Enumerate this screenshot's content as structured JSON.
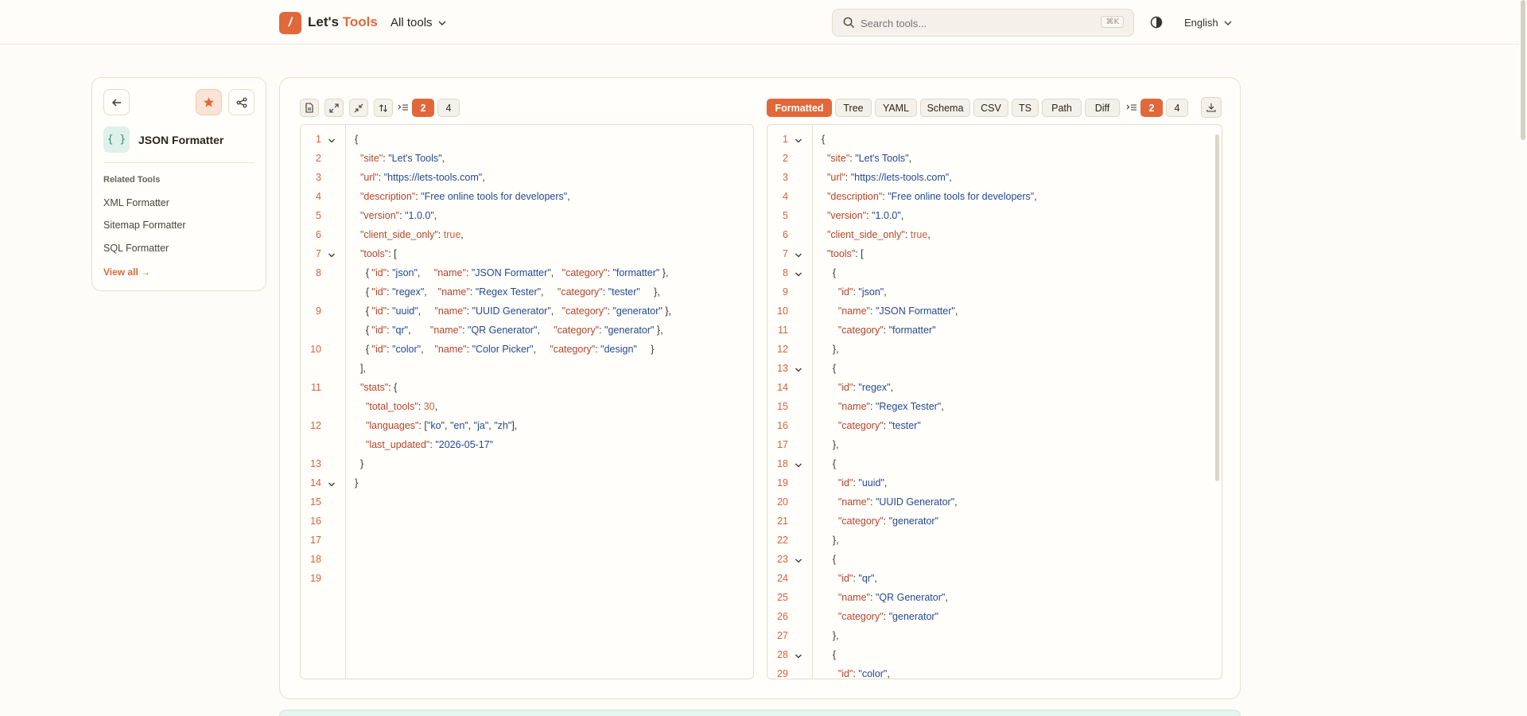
{
  "header": {
    "logo_mark": "/",
    "logo_part1": "Let's ",
    "logo_part2": "Tools",
    "all_tools_label": "All tools",
    "search_placeholder": "Search tools...",
    "search_shortcut": "⌘K",
    "language": "English",
    "accent_color": "#e0683a"
  },
  "sidebar": {
    "tool_icon_glyph": "{ }",
    "tool_name": "JSON Formatter",
    "related_title": "Related Tools",
    "related_items": [
      "XML Formatter",
      "Sitemap Formatter",
      "SQL Formatter"
    ],
    "view_all": "View all →"
  },
  "toolbar_left": {
    "indent_options": [
      "2",
      "4"
    ],
    "active_indent": "2"
  },
  "toolbar_right": {
    "view_tabs": [
      "Formatted",
      "Tree",
      "YAML",
      "Schema",
      "CSV",
      "TS",
      "Path",
      "Diff"
    ],
    "active_tab": "Formatted",
    "indent_options": [
      "2",
      "4"
    ],
    "active_indent": "2"
  },
  "input_editor": {
    "line_numbers": [
      "1",
      "2",
      "3",
      "4",
      "5",
      "6",
      "7",
      "8",
      "",
      "9",
      "",
      "10",
      "",
      "11",
      "",
      "12",
      "",
      "13",
      "14",
      "15",
      "16",
      "17",
      "18",
      "19"
    ],
    "lines": [
      [
        [
          "p",
          "{"
        ]
      ],
      [
        [
          "p",
          "  "
        ],
        [
          "k",
          "\"site\""
        ],
        [
          "p",
          ": "
        ],
        [
          "s",
          "\"Let's Tools\""
        ],
        [
          "p",
          ","
        ]
      ],
      [
        [
          "p",
          "  "
        ],
        [
          "k",
          "\"url\""
        ],
        [
          "p",
          ": "
        ],
        [
          "s",
          "\"https://lets-tools.com\""
        ],
        [
          "p",
          ","
        ]
      ],
      [
        [
          "p",
          "  "
        ],
        [
          "k",
          "\"description\""
        ],
        [
          "p",
          ": "
        ],
        [
          "s",
          "\"Free online tools for developers\""
        ],
        [
          "p",
          ","
        ]
      ],
      [
        [
          "p",
          "  "
        ],
        [
          "k",
          "\"version\""
        ],
        [
          "p",
          ": "
        ],
        [
          "s",
          "\"1.0.0\""
        ],
        [
          "p",
          ","
        ]
      ],
      [
        [
          "p",
          "  "
        ],
        [
          "k",
          "\"client_side_only\""
        ],
        [
          "p",
          ": "
        ],
        [
          "n",
          "true"
        ],
        [
          "p",
          ","
        ]
      ],
      [
        [
          "p",
          "  "
        ],
        [
          "k",
          "\"tools\""
        ],
        [
          "p",
          ": ["
        ]
      ],
      [
        [
          "p",
          "    { "
        ],
        [
          "k",
          "\"id\""
        ],
        [
          "p",
          ": "
        ],
        [
          "s",
          "\"json\""
        ],
        [
          "p",
          ",     "
        ],
        [
          "k",
          "\"name\""
        ],
        [
          "p",
          ": "
        ],
        [
          "s",
          "\"JSON Formatter\""
        ],
        [
          "p",
          ",   "
        ],
        [
          "k",
          "\"category\""
        ],
        [
          "p",
          ": "
        ],
        [
          "s",
          "\"formatter\""
        ],
        [
          "p",
          " },"
        ]
      ],
      [
        [
          "p",
          "    { "
        ],
        [
          "k",
          "\"id\""
        ],
        [
          "p",
          ": "
        ],
        [
          "s",
          "\"regex\""
        ],
        [
          "p",
          ",    "
        ],
        [
          "k",
          "\"name\""
        ],
        [
          "p",
          ": "
        ],
        [
          "s",
          "\"Regex Tester\""
        ],
        [
          "p",
          ",     "
        ],
        [
          "k",
          "\"category\""
        ],
        [
          "p",
          ": "
        ],
        [
          "s",
          "\"tester\""
        ],
        [
          "p",
          "     },"
        ]
      ],
      [
        [
          "p",
          "    { "
        ],
        [
          "k",
          "\"id\""
        ],
        [
          "p",
          ": "
        ],
        [
          "s",
          "\"uuid\""
        ],
        [
          "p",
          ",     "
        ],
        [
          "k",
          "\"name\""
        ],
        [
          "p",
          ": "
        ],
        [
          "s",
          "\"UUID Generator\""
        ],
        [
          "p",
          ",   "
        ],
        [
          "k",
          "\"category\""
        ],
        [
          "p",
          ": "
        ],
        [
          "s",
          "\"generator\""
        ],
        [
          "p",
          " },"
        ]
      ],
      [
        [
          "p",
          "    { "
        ],
        [
          "k",
          "\"id\""
        ],
        [
          "p",
          ": "
        ],
        [
          "s",
          "\"qr\""
        ],
        [
          "p",
          ",       "
        ],
        [
          "k",
          "\"name\""
        ],
        [
          "p",
          ": "
        ],
        [
          "s",
          "\"QR Generator\""
        ],
        [
          "p",
          ",     "
        ],
        [
          "k",
          "\"category\""
        ],
        [
          "p",
          ": "
        ],
        [
          "s",
          "\"generator\""
        ],
        [
          "p",
          " },"
        ]
      ],
      [
        [
          "p",
          "    { "
        ],
        [
          "k",
          "\"id\""
        ],
        [
          "p",
          ": "
        ],
        [
          "s",
          "\"color\""
        ],
        [
          "p",
          ",    "
        ],
        [
          "k",
          "\"name\""
        ],
        [
          "p",
          ": "
        ],
        [
          "s",
          "\"Color Picker\""
        ],
        [
          "p",
          ",     "
        ],
        [
          "k",
          "\"category\""
        ],
        [
          "p",
          ": "
        ],
        [
          "s",
          "\"design\""
        ],
        [
          "p",
          "     }"
        ]
      ],
      [
        [
          "p",
          "  ],"
        ]
      ],
      [
        [
          "p",
          "  "
        ],
        [
          "k",
          "\"stats\""
        ],
        [
          "p",
          ": {"
        ]
      ],
      [
        [
          "p",
          "    "
        ],
        [
          "k",
          "\"total_tools\""
        ],
        [
          "p",
          ": "
        ],
        [
          "n",
          "30"
        ],
        [
          "p",
          ","
        ]
      ],
      [
        [
          "p",
          "    "
        ],
        [
          "k",
          "\"languages\""
        ],
        [
          "p",
          ": ["
        ],
        [
          "s",
          "\"ko\""
        ],
        [
          "p",
          ", "
        ],
        [
          "s",
          "\"en\""
        ],
        [
          "p",
          ", "
        ],
        [
          "s",
          "\"ja\""
        ],
        [
          "p",
          ", "
        ],
        [
          "s",
          "\"zh\""
        ],
        [
          "p",
          "],"
        ]
      ],
      [
        [
          "p",
          "    "
        ],
        [
          "k",
          "\"last_updated\""
        ],
        [
          "p",
          ": "
        ],
        [
          "s",
          "\"2026-05-17\""
        ]
      ],
      [
        [
          "p",
          "  }"
        ]
      ],
      [
        [
          "p",
          "}"
        ]
      ]
    ]
  },
  "output_editor": {
    "line_numbers": [
      "1",
      "2",
      "3",
      "4",
      "5",
      "6",
      "7",
      "8",
      "9",
      "10",
      "11",
      "12",
      "13",
      "14",
      "15",
      "16",
      "17",
      "18",
      "19",
      "20",
      "21",
      "22",
      "23",
      "24",
      "25",
      "26",
      "27",
      "28",
      "29"
    ],
    "lines": [
      [
        [
          "p",
          "{"
        ]
      ],
      [
        [
          "p",
          "  "
        ],
        [
          "k",
          "\"site\""
        ],
        [
          "p",
          ": "
        ],
        [
          "s",
          "\"Let's Tools\""
        ],
        [
          "p",
          ","
        ]
      ],
      [
        [
          "p",
          "  "
        ],
        [
          "k",
          "\"url\""
        ],
        [
          "p",
          ": "
        ],
        [
          "s",
          "\"https://lets-tools.com\""
        ],
        [
          "p",
          ","
        ]
      ],
      [
        [
          "p",
          "  "
        ],
        [
          "k",
          "\"description\""
        ],
        [
          "p",
          ": "
        ],
        [
          "s",
          "\"Free online tools for developers\""
        ],
        [
          "p",
          ","
        ]
      ],
      [
        [
          "p",
          "  "
        ],
        [
          "k",
          "\"version\""
        ],
        [
          "p",
          ": "
        ],
        [
          "s",
          "\"1.0.0\""
        ],
        [
          "p",
          ","
        ]
      ],
      [
        [
          "p",
          "  "
        ],
        [
          "k",
          "\"client_side_only\""
        ],
        [
          "p",
          ": "
        ],
        [
          "n",
          "true"
        ],
        [
          "p",
          ","
        ]
      ],
      [
        [
          "p",
          "  "
        ],
        [
          "k",
          "\"tools\""
        ],
        [
          "p",
          ": ["
        ]
      ],
      [
        [
          "p",
          "    {"
        ]
      ],
      [
        [
          "p",
          "      "
        ],
        [
          "k",
          "\"id\""
        ],
        [
          "p",
          ": "
        ],
        [
          "s",
          "\"json\""
        ],
        [
          "p",
          ","
        ]
      ],
      [
        [
          "p",
          "      "
        ],
        [
          "k",
          "\"name\""
        ],
        [
          "p",
          ": "
        ],
        [
          "s",
          "\"JSON Formatter\""
        ],
        [
          "p",
          ","
        ]
      ],
      [
        [
          "p",
          "      "
        ],
        [
          "k",
          "\"category\""
        ],
        [
          "p",
          ": "
        ],
        [
          "s",
          "\"formatter\""
        ]
      ],
      [
        [
          "p",
          "    },"
        ]
      ],
      [
        [
          "p",
          "    {"
        ]
      ],
      [
        [
          "p",
          "      "
        ],
        [
          "k",
          "\"id\""
        ],
        [
          "p",
          ": "
        ],
        [
          "s",
          "\"regex\""
        ],
        [
          "p",
          ","
        ]
      ],
      [
        [
          "p",
          "      "
        ],
        [
          "k",
          "\"name\""
        ],
        [
          "p",
          ": "
        ],
        [
          "s",
          "\"Regex Tester\""
        ],
        [
          "p",
          ","
        ]
      ],
      [
        [
          "p",
          "      "
        ],
        [
          "k",
          "\"category\""
        ],
        [
          "p",
          ": "
        ],
        [
          "s",
          "\"tester\""
        ]
      ],
      [
        [
          "p",
          "    },"
        ]
      ],
      [
        [
          "p",
          "    {"
        ]
      ],
      [
        [
          "p",
          "      "
        ],
        [
          "k",
          "\"id\""
        ],
        [
          "p",
          ": "
        ],
        [
          "s",
          "\"uuid\""
        ],
        [
          "p",
          ","
        ]
      ],
      [
        [
          "p",
          "      "
        ],
        [
          "k",
          "\"name\""
        ],
        [
          "p",
          ": "
        ],
        [
          "s",
          "\"UUID Generator\""
        ],
        [
          "p",
          ","
        ]
      ],
      [
        [
          "p",
          "      "
        ],
        [
          "k",
          "\"category\""
        ],
        [
          "p",
          ": "
        ],
        [
          "s",
          "\"generator\""
        ]
      ],
      [
        [
          "p",
          "    },"
        ]
      ],
      [
        [
          "p",
          "    {"
        ]
      ],
      [
        [
          "p",
          "      "
        ],
        [
          "k",
          "\"id\""
        ],
        [
          "p",
          ": "
        ],
        [
          "s",
          "\"qr\""
        ],
        [
          "p",
          ","
        ]
      ],
      [
        [
          "p",
          "      "
        ],
        [
          "k",
          "\"name\""
        ],
        [
          "p",
          ": "
        ],
        [
          "s",
          "\"QR Generator\""
        ],
        [
          "p",
          ","
        ]
      ],
      [
        [
          "p",
          "      "
        ],
        [
          "k",
          "\"category\""
        ],
        [
          "p",
          ": "
        ],
        [
          "s",
          "\"generator\""
        ]
      ],
      [
        [
          "p",
          "    },"
        ]
      ],
      [
        [
          "p",
          "    {"
        ]
      ],
      [
        [
          "p",
          "      "
        ],
        [
          "k",
          "\"id\""
        ],
        [
          "p",
          ": "
        ],
        [
          "s",
          "\"color\""
        ],
        [
          "p",
          ","
        ]
      ]
    ]
  }
}
